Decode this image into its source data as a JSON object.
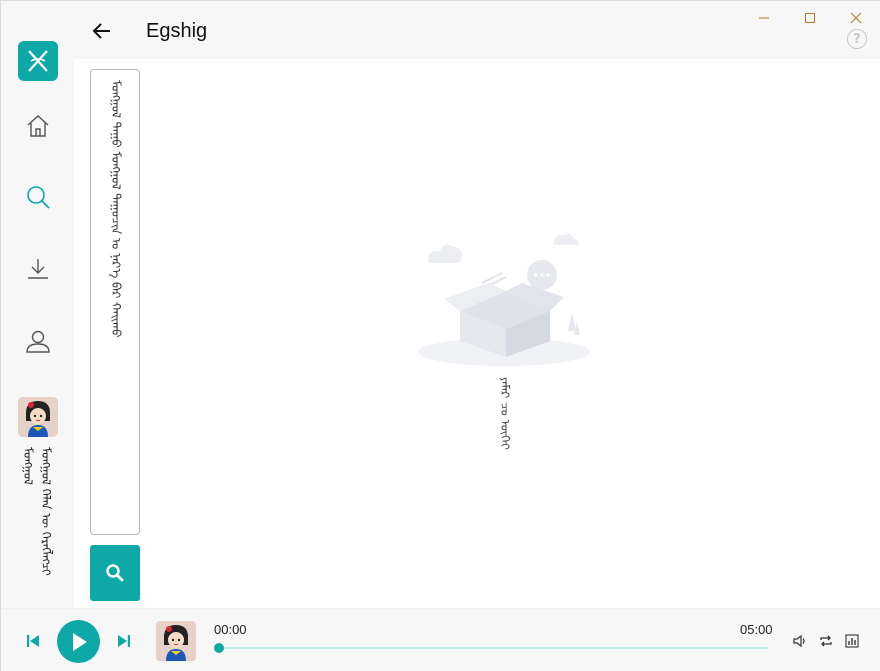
{
  "app": {
    "title": "Egshig"
  },
  "colors": {
    "accent": "#0ea9a7",
    "accent_light": "#bfe9e6",
    "background": "#f7f7f8"
  },
  "sidebar": {
    "logo_icon": "egshig-logo-icon",
    "items": [
      {
        "name": "home",
        "icon": "home-icon",
        "active": false
      },
      {
        "name": "search",
        "icon": "search-icon",
        "active": true
      },
      {
        "name": "download",
        "icon": "download-icon",
        "active": false
      },
      {
        "name": "profile",
        "icon": "user-icon",
        "active": false
      }
    ],
    "user": {
      "name_line1": "ᠮᠣᠩᠭᠣᠯ",
      "name_line2": "ᠮᠣᠩᠭᠣᠯ ᠬᠡᠯᠡᠨ ᠦ ᠬᠡᠷᠡᠭᠯᠡᠭᠴᠢ"
    }
  },
  "search": {
    "placeholder": "ᠮᠣᠩᠭᠣᠯ ᠳᠠᠭᠤ ᠮᠣᠩᠭᠣᠯ ᠳᠠᠭᠤᠴᠢᠨ ᠤ ᠨᠡᠷ᠎ᠡ ᠪᠡᠷ ᠬᠠᠢᠬᠤ",
    "button_icon": "search-icon"
  },
  "empty_state": {
    "illustration": "empty-box-illustration",
    "text": "ᠶᠠᠮᠠᠷ ᠴᠤ ᠦᠭᠡᠢ"
  },
  "player": {
    "current_time": "00:00",
    "total_time": "05:00",
    "progress": 0.0,
    "icons": [
      "previous-icon",
      "play-icon",
      "next-icon",
      "volume-icon",
      "repeat-icon",
      "equalizer-icon"
    ]
  },
  "window_controls": [
    "minimize-icon",
    "maximize-icon",
    "close-icon",
    "help-icon"
  ]
}
